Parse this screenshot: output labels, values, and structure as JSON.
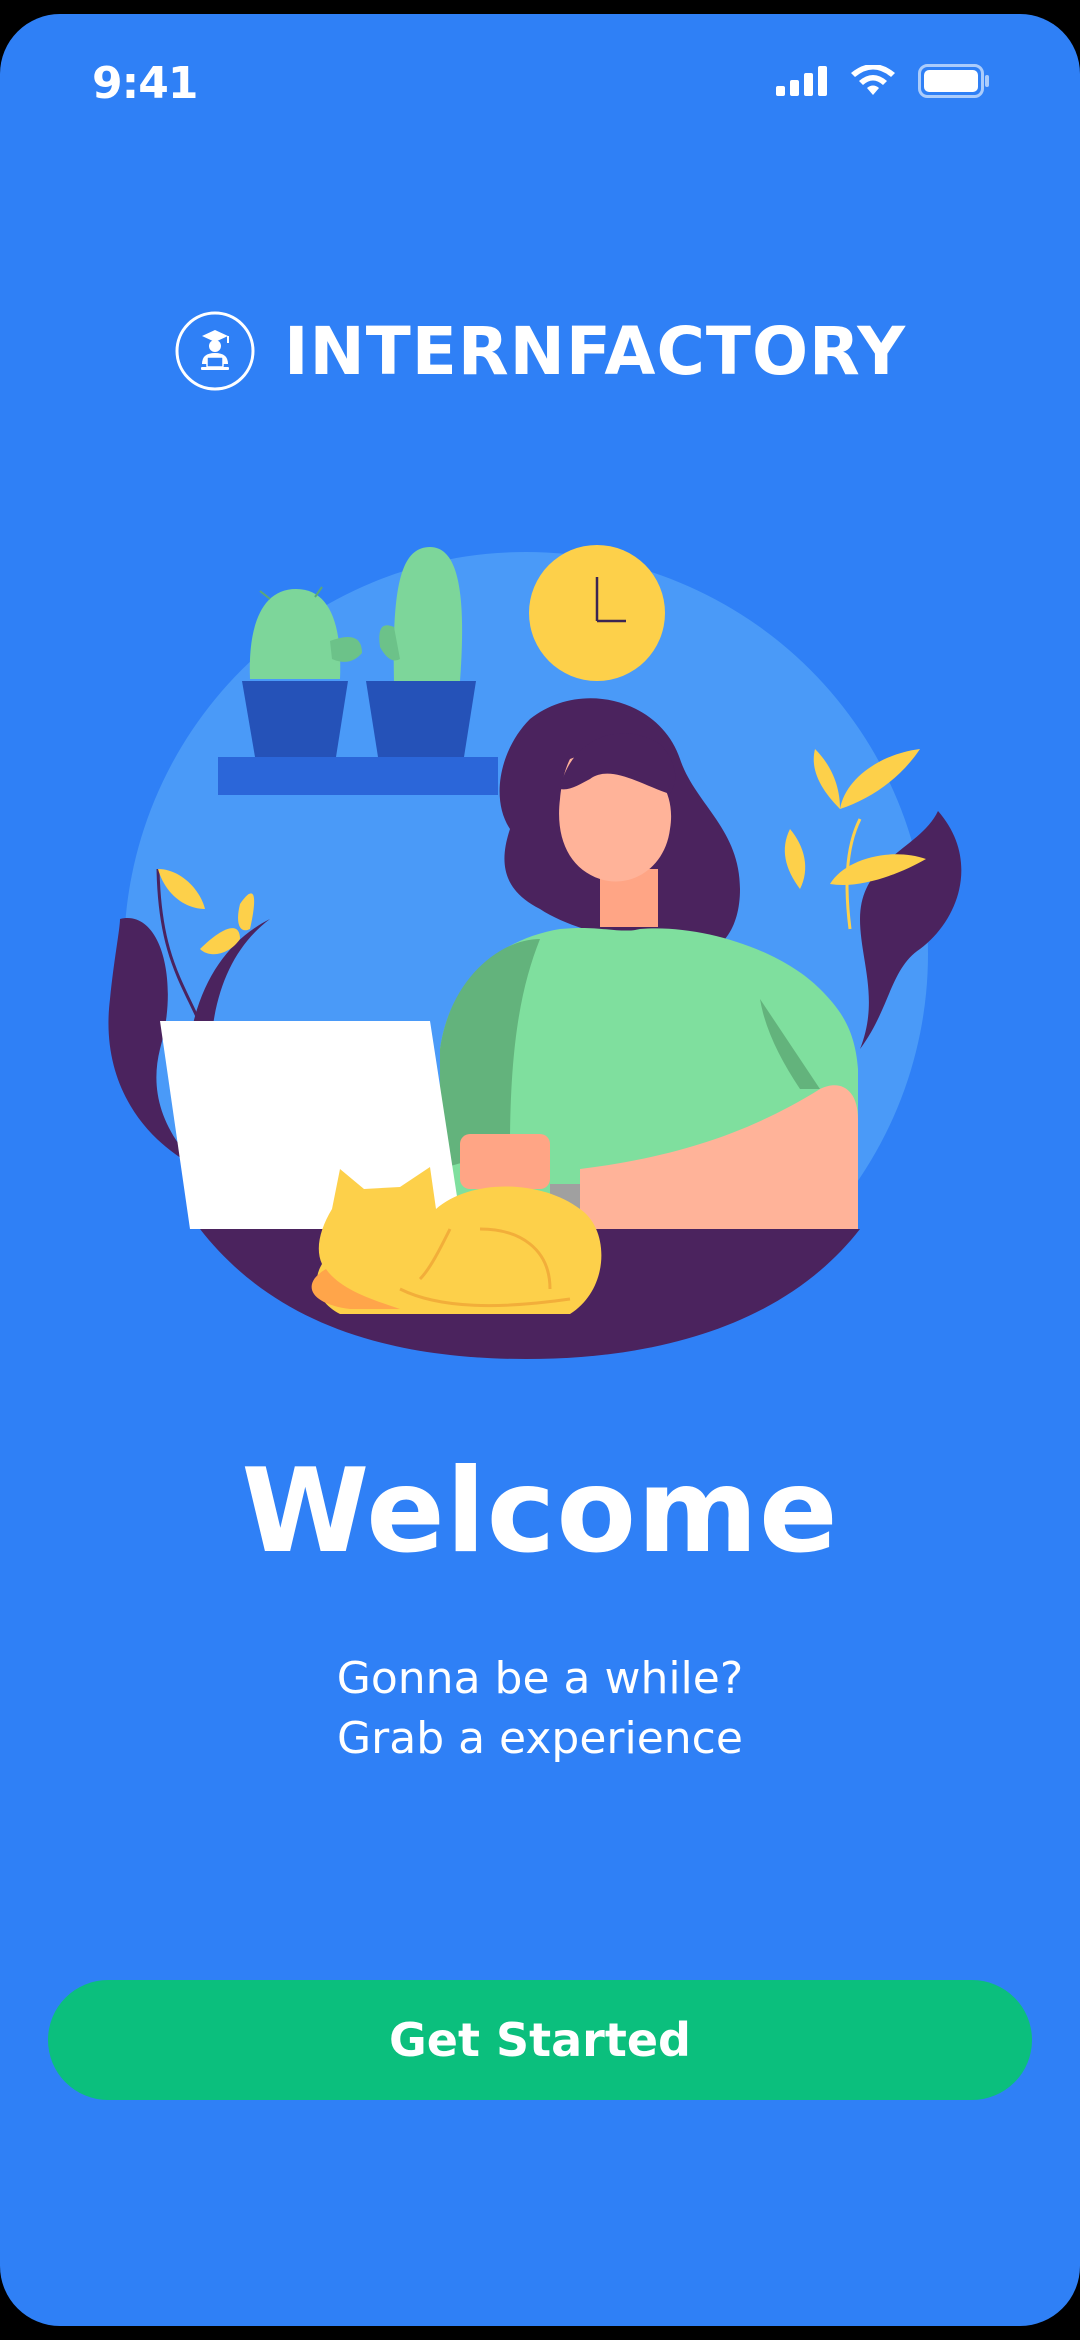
{
  "status_bar": {
    "time": "9:41",
    "icons": [
      "signal-icon",
      "wifi-icon",
      "battery-icon"
    ]
  },
  "brand": {
    "name": "INTERNFACTORY",
    "logo_icon": "intern-logo-icon"
  },
  "welcome": {
    "title": "Welcome",
    "subtitle_line1": "Gonna be a while?",
    "subtitle_line2": "Grab a experience"
  },
  "actions": {
    "get_started_label": "Get Started"
  },
  "colors": {
    "background": "#2F80F6",
    "button": "#0BBF7D",
    "text": "#FFFFFF"
  }
}
